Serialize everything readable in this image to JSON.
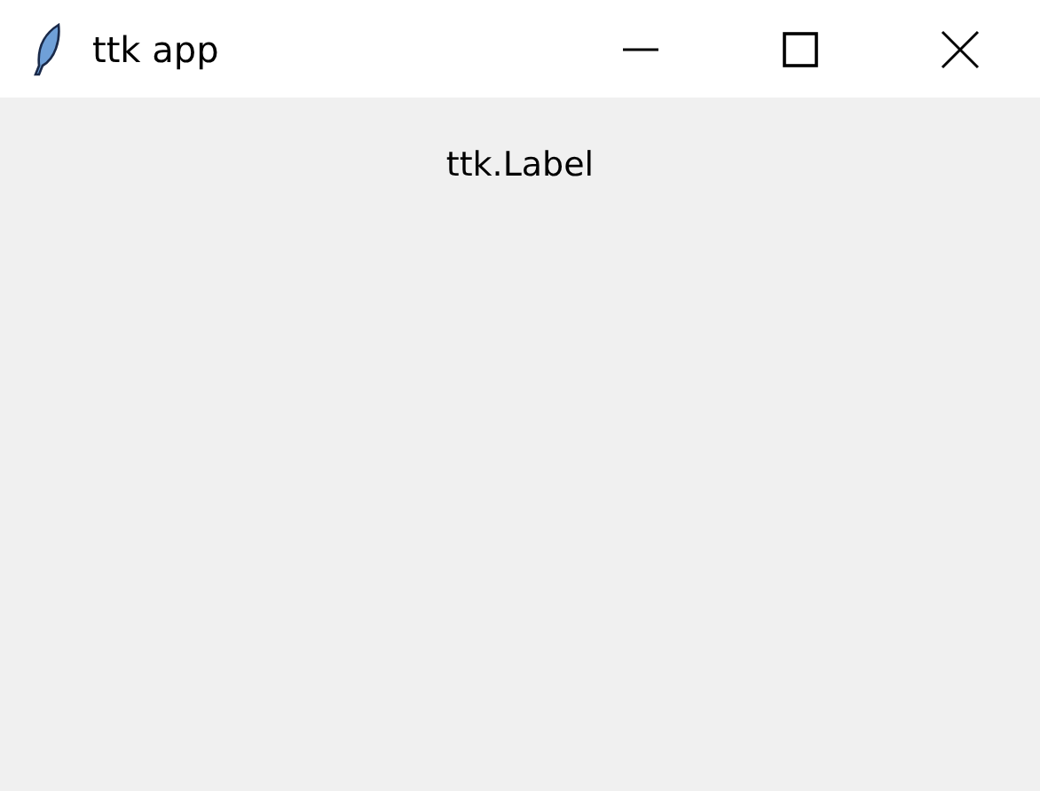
{
  "window": {
    "title": "ttk app"
  },
  "label": {
    "text": "ttk.Label"
  }
}
